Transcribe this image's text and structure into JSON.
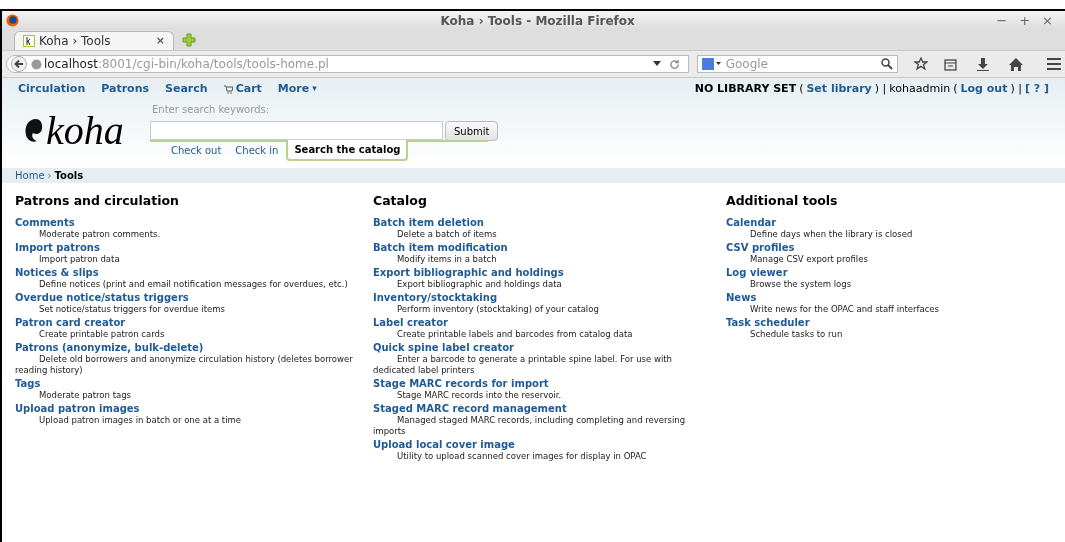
{
  "window": {
    "title": "Koha › Tools - Mozilla Firefox",
    "controls": [
      "−",
      "+",
      "×"
    ]
  },
  "browser_tab": {
    "title": "Koha › Tools",
    "close": "×",
    "selected": true
  },
  "address_bar": {
    "host": "localhost",
    "path": ":8001/cgi-bin/koha/tools/tools-home.pl"
  },
  "search_bar": {
    "placeholder": "Google"
  },
  "nav": [
    {
      "label": "Circulation",
      "kind": "link"
    },
    {
      "label": "Patrons",
      "kind": "link"
    },
    {
      "label": "Search",
      "kind": "link"
    },
    {
      "label": "Cart",
      "kind": "cart"
    },
    {
      "label": "More",
      "kind": "menu",
      "caret": "▾"
    }
  ],
  "user_bar": [
    {
      "kind": "strong",
      "text": "NO LIBRARY SET"
    },
    {
      "kind": "text",
      "text": "("
    },
    {
      "kind": "link",
      "text": "Set library"
    },
    {
      "kind": "text",
      "text": ") |"
    },
    {
      "kind": "text",
      "text": "kohaadmin"
    },
    {
      "kind": "text",
      "text": "("
    },
    {
      "kind": "link",
      "text": "Log out"
    },
    {
      "kind": "text",
      "text": ") |"
    },
    {
      "kind": "link",
      "text": "[ ? ]"
    }
  ],
  "logo": "koha",
  "search": {
    "label": "Enter search keywords:",
    "button": "Submit",
    "tabs": [
      {
        "label": "Check out",
        "selected": false
      },
      {
        "label": "Check in",
        "selected": false
      },
      {
        "label": "Search the catalog",
        "selected": true
      }
    ]
  },
  "breadcrumb": [
    {
      "kind": "link",
      "label": "Home"
    },
    {
      "kind": "separator",
      "label": "›"
    },
    {
      "kind": "current",
      "label": "Tools"
    }
  ],
  "sections": [
    {
      "title": "Patrons and circulation",
      "items": [
        {
          "name": "Comments",
          "desc": "Moderate patron comments."
        },
        {
          "name": "Import patrons",
          "desc": "Import patron data"
        },
        {
          "name": "Notices & slips",
          "desc": "Define notices (print and email notification messages for overdues, etc.)"
        },
        {
          "name": "Overdue notice/status triggers",
          "desc": "Set notice/status triggers for overdue items"
        },
        {
          "name": "Patron card creator",
          "desc": "Create printable patron cards"
        },
        {
          "name": "Patrons (anonymize, bulk-delete)",
          "desc": "Delete old borrowers and anonymize circulation history (deletes borrower reading history)"
        },
        {
          "name": "Tags",
          "desc": "Moderate patron tags"
        },
        {
          "name": "Upload patron images",
          "desc": "Upload patron images in batch or one at a time"
        }
      ]
    },
    {
      "title": "Catalog",
      "items": [
        {
          "name": "Batch item deletion",
          "desc": "Delete a batch of items"
        },
        {
          "name": "Batch item modification",
          "desc": "Modify items in a batch"
        },
        {
          "name": "Export bibliographic and holdings",
          "desc": "Export bibliographic and holdings data"
        },
        {
          "name": "Inventory/stocktaking",
          "desc": "Perform inventory (stocktaking) of your catalog"
        },
        {
          "name": "Label creator",
          "desc": "Create printable labels and barcodes from catalog data"
        },
        {
          "name": "Quick spine label creator",
          "desc": "Enter a barcode to generate a printable spine label. For use with dedicated label printers"
        },
        {
          "name": "Stage MARC records for import",
          "desc": "Stage MARC records into the reservoir."
        },
        {
          "name": "Staged MARC record management",
          "desc": "Managed staged MARC records, including completing and reversing imports"
        },
        {
          "name": "Upload local cover image",
          "desc": "Utility to upload scanned cover images for display in OPAC"
        }
      ]
    },
    {
      "title": "Additional tools",
      "items": [
        {
          "name": "Calendar",
          "desc": "Define days when the library is closed"
        },
        {
          "name": "CSV profiles",
          "desc": "Manage CSV export profiles"
        },
        {
          "name": "Log viewer",
          "desc": "Browse the system logs"
        },
        {
          "name": "News",
          "desc": "Write news for the OPAC and staff interfaces"
        },
        {
          "name": "Task scheduler",
          "desc": "Schedule tasks to run"
        }
      ]
    }
  ]
}
